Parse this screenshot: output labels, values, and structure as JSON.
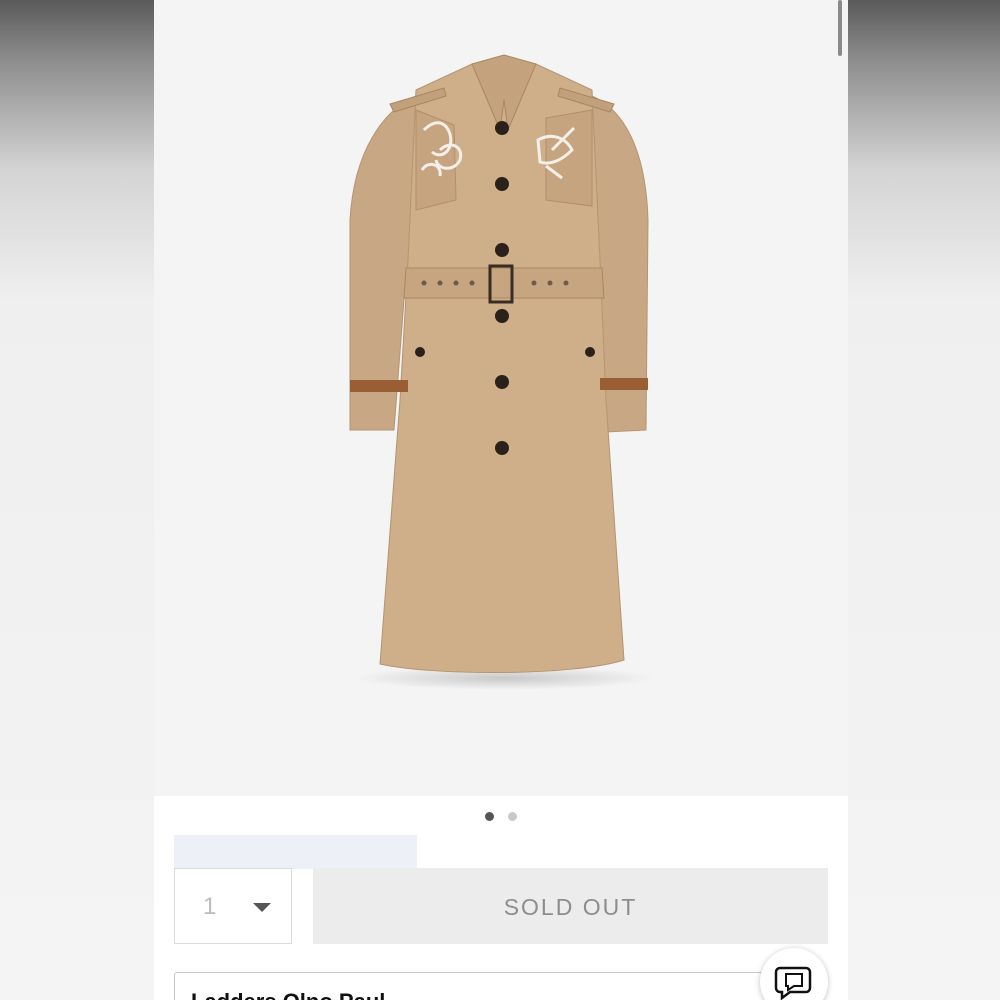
{
  "product": {
    "image_icon": "trench-coat-product-image",
    "image_count": 2,
    "active_image": 1
  },
  "purchase": {
    "quantity": "1",
    "sold_out_label": "SOLD OUT"
  },
  "store_pickup": {
    "label": "Ladders Olno Paul"
  },
  "chat": {
    "icon": "chat-bubble-icon"
  }
}
